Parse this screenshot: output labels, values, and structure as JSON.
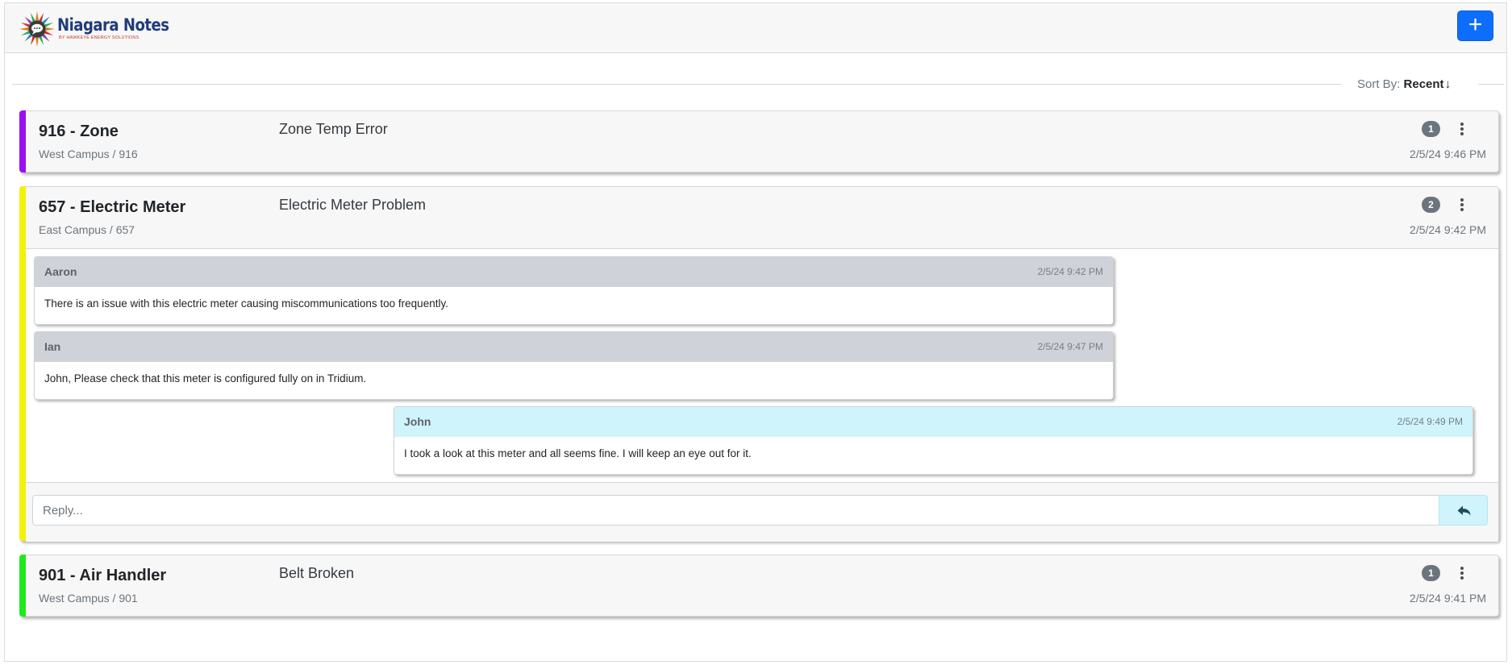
{
  "app": {
    "title": "Niagara Notes",
    "subtitle": "BY HAWKEYE ENERGY SOLUTIONS",
    "add_label": "+",
    "colors": {
      "primary": "#0d6efd",
      "info": "#cff4fc",
      "badge": "#6c757d"
    }
  },
  "sort": {
    "label": "Sort By:",
    "value": "Recent",
    "arrow": "↓"
  },
  "notes": [
    {
      "title": "916 - Zone",
      "location": "West Campus / 916",
      "subject": "Zone Temp Error",
      "count": "1",
      "date": "2/5/24 9:46 PM",
      "accent": "#9b10f0"
    },
    {
      "title": "657 - Electric Meter",
      "location": "East Campus / 657",
      "subject": "Electric Meter Problem",
      "count": "2",
      "date": "2/5/24 9:42 PM",
      "accent": "#f2f20a",
      "messages": [
        {
          "author": "Aaron",
          "date": "2/5/24 9:42 PM",
          "text": "There is an issue with this electric meter causing miscommunications too frequently."
        },
        {
          "author": "Ian",
          "date": "2/5/24 9:47 PM",
          "text": "John, Please check that this meter is configured fully on in Tridium."
        },
        {
          "author": "John",
          "date": "2/5/24 9:49 PM",
          "text": "I took a look at this meter and all seems fine. I will keep an eye out for it."
        }
      ],
      "reply_placeholder": "Reply...",
      "reply_icon": "reply-icon"
    },
    {
      "title": "901 - Air Handler",
      "location": "West Campus / 901",
      "subject": "Belt Broken",
      "count": "1",
      "date": "2/5/24 9:41 PM",
      "accent": "#1fe81f"
    }
  ]
}
